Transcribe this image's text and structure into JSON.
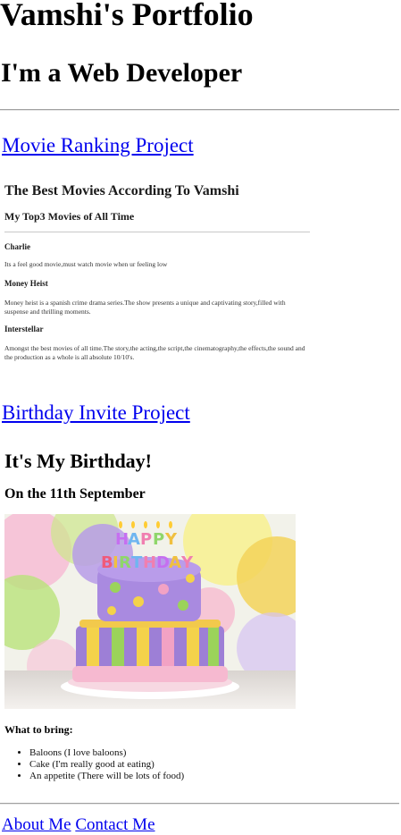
{
  "header": {
    "title": "Vamshi's Portfolio",
    "subtitle": "I'm a Web Developer"
  },
  "projects": [
    {
      "label": "Movie Ranking Project"
    },
    {
      "label": "Birthday Invite Project"
    }
  ],
  "movie_frame": {
    "title": "The Best Movies According To Vamshi",
    "subtitle": "My Top3 Movies of All Time",
    "movies": [
      {
        "name": "Charlie",
        "description": "Its a feel good movie,must watch movie when ur feeling low"
      },
      {
        "name": "Money Heist",
        "description": "Money heist is a spanish crime drama series.The show presents a unique and captivating story,filled with suspense and thrilling moments."
      },
      {
        "name": "Interstellar",
        "description": "Amongst the best movies of all time.The story,the acting,the script,the cinematography,the effects,the sound and the production as a whole is all absolute 10/10's."
      }
    ]
  },
  "birthday_frame": {
    "title": "It's My Birthday!",
    "date": "On the 11th September",
    "cake_banner": "HAPPY BIRTHDAY",
    "bring_heading": "What to bring:",
    "bring_items": [
      "Baloons (I love baloons)",
      "Cake (I'm really good at eating)",
      "An appetite (There will be lots of food)"
    ]
  },
  "footer": {
    "about_label": "About Me",
    "contact_label": "Contact Me"
  },
  "colors": {
    "link": "#0000ee",
    "text": "#000000"
  }
}
